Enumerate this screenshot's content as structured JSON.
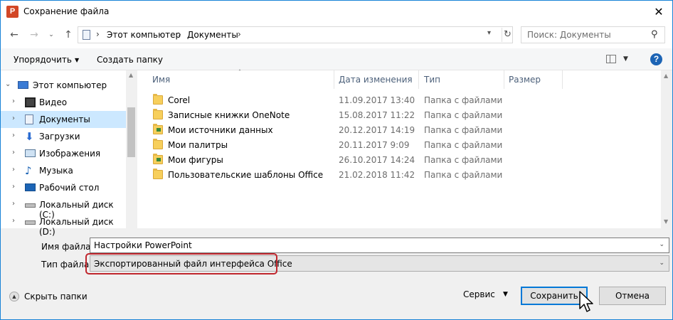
{
  "window": {
    "title": "Сохранение файла",
    "close_label": "✕",
    "app_icon_letter": "P"
  },
  "address": {
    "crumbs": [
      "Этот компьютер",
      "Документы"
    ],
    "search_placeholder": "Поиск: Документы"
  },
  "toolbar": {
    "organize_label": "Упорядочить",
    "new_folder_label": "Создать папку"
  },
  "sidebar": {
    "items": [
      {
        "label": "Этот компьютер",
        "icon": "computer-icon"
      },
      {
        "label": "Видео",
        "icon": "video-icon"
      },
      {
        "label": "Документы",
        "icon": "documents-icon",
        "selected": true
      },
      {
        "label": "Загрузки",
        "icon": "downloads-icon"
      },
      {
        "label": "Изображения",
        "icon": "images-icon"
      },
      {
        "label": "Музыка",
        "icon": "music-icon"
      },
      {
        "label": "Рабочий стол",
        "icon": "desktop-icon"
      },
      {
        "label": "Локальный диск (C:)",
        "icon": "drive-icon"
      },
      {
        "label": "Локальный диск (D:)",
        "icon": "drive-icon"
      }
    ]
  },
  "file_list": {
    "columns": [
      "Имя",
      "Дата изменения",
      "Тип",
      "Размер"
    ],
    "rows": [
      {
        "name": "Corel",
        "date": "11.09.2017 13:40",
        "type": "Папка с файлами"
      },
      {
        "name": "Записные книжки OneNote",
        "date": "15.08.2017 11:22",
        "type": "Папка с файлами"
      },
      {
        "name": "Мои источники данных",
        "date": "20.12.2017 14:19",
        "type": "Папка с файлами"
      },
      {
        "name": "Мои палитры",
        "date": "20.11.2017 9:09",
        "type": "Папка с файлами"
      },
      {
        "name": "Мои фигуры",
        "date": "26.10.2017 14:24",
        "type": "Папка с файлами"
      },
      {
        "name": "Пользовательские шаблоны Office",
        "date": "21.02.2018 11:42",
        "type": "Папка с файлами"
      }
    ]
  },
  "form": {
    "filename_label": "Имя файла:",
    "filename_value": "Настройки PowerPoint",
    "filetype_label": "Тип файла",
    "filetype_value": "Экспортированный файл интерфейса Office"
  },
  "footer": {
    "hide_folders_label": "Скрыть папки",
    "service_label": "Сервис",
    "save_label": "Сохранить",
    "cancel_label": "Отмена"
  },
  "colors": {
    "accent": "#0078d7",
    "selection": "#cce8ff",
    "highlight_border": "#c0262d"
  }
}
